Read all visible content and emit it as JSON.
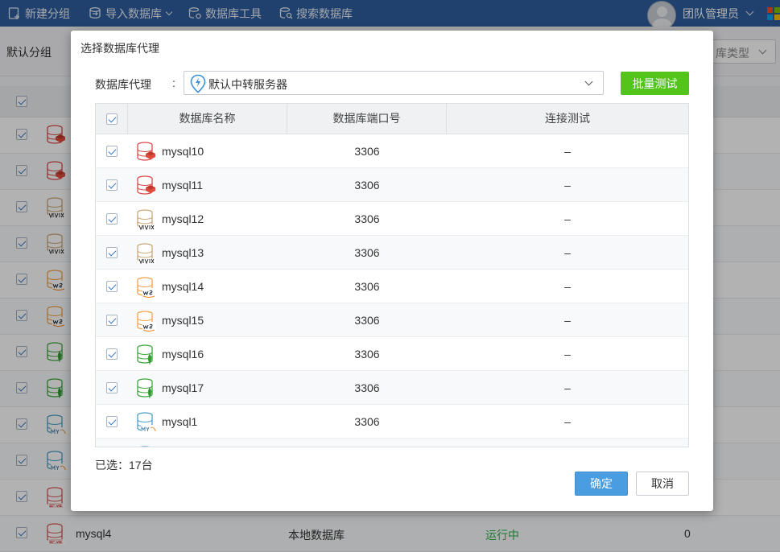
{
  "colors": {
    "topbar": "#2f5e9c",
    "primary_button": "#4a9de0",
    "batch_button": "#52c41a",
    "status_running": "#2fb14a",
    "redis": "#d94a4a",
    "vertica": "#c9a878",
    "aws": "#f0a24a",
    "mongodb": "#3da63d",
    "mysql": "#4a9fc8",
    "oracle": "#d45a5a"
  },
  "toolbar": {
    "items": [
      {
        "label": "新建分组",
        "icon": "new-group-icon"
      },
      {
        "label": "导入数据库",
        "icon": "import-db-icon"
      },
      {
        "label": "数据库工具",
        "icon": "db-tools-icon"
      },
      {
        "label": "搜索数据库",
        "icon": "search-db-icon"
      }
    ],
    "user_name": "团队管理员"
  },
  "background": {
    "group_title": "默认分组",
    "type_filter_placeholder": "库类型",
    "rows": [
      {
        "icon": "redis"
      },
      {
        "icon": "redis"
      },
      {
        "icon": "vertica"
      },
      {
        "icon": "vertica"
      },
      {
        "icon": "aws"
      },
      {
        "icon": "aws"
      },
      {
        "icon": "mongodb"
      },
      {
        "icon": "mongodb"
      },
      {
        "icon": "mysql"
      },
      {
        "icon": "mysql"
      },
      {
        "icon": "oracle"
      },
      {
        "icon": "oracle",
        "name": "mysql4",
        "type": "本地数据库",
        "status": "运行中",
        "count": "0"
      }
    ]
  },
  "dialog": {
    "title": "选择数据库代理",
    "proxy_label": "数据库代理",
    "proxy_colon": ":",
    "proxy_value": "默认中转服务器",
    "batch_test_label": "批量测试",
    "columns": [
      "数据库名称",
      "数据库端口号",
      "连接测试"
    ],
    "rows": [
      {
        "name": "mysql10",
        "port": "3306",
        "test": "–",
        "icon": "redis"
      },
      {
        "name": "mysql11",
        "port": "3306",
        "test": "–",
        "icon": "redis"
      },
      {
        "name": "mysql12",
        "port": "3306",
        "test": "–",
        "icon": "vertica"
      },
      {
        "name": "mysql13",
        "port": "3306",
        "test": "–",
        "icon": "vertica"
      },
      {
        "name": "mysql14",
        "port": "3306",
        "test": "–",
        "icon": "aws"
      },
      {
        "name": "mysql15",
        "port": "3306",
        "test": "–",
        "icon": "aws"
      },
      {
        "name": "mysql16",
        "port": "3306",
        "test": "–",
        "icon": "mongodb"
      },
      {
        "name": "mysql17",
        "port": "3306",
        "test": "–",
        "icon": "mongodb"
      },
      {
        "name": "mysql1",
        "port": "3306",
        "test": "–",
        "icon": "mysql"
      },
      {
        "name": "",
        "port": "",
        "test": "",
        "icon": "mysql"
      }
    ],
    "selected_text": "已选：17台",
    "ok_label": "确定",
    "cancel_label": "取消"
  }
}
